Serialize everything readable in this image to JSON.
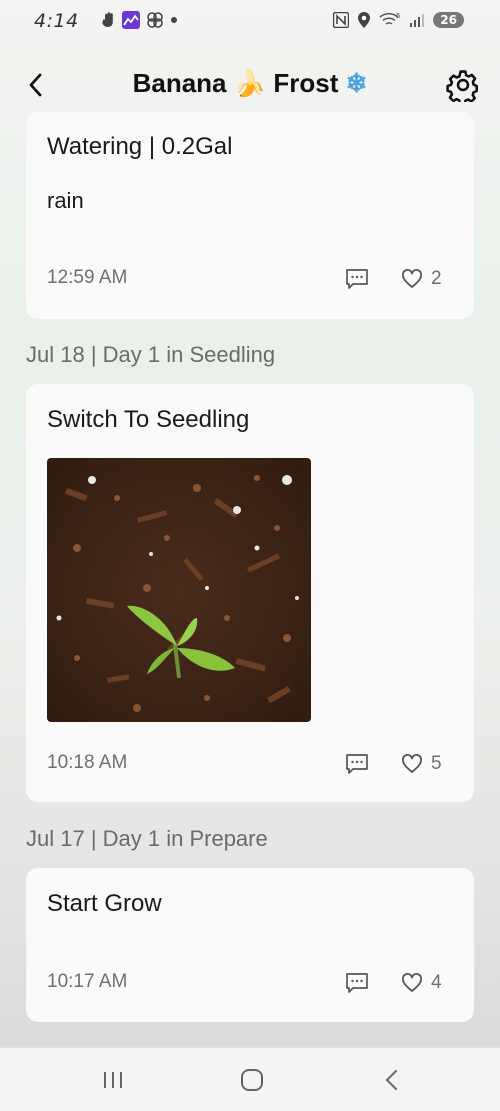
{
  "status_bar": {
    "time": "4:14",
    "battery": "26",
    "signal_label": "5"
  },
  "header": {
    "title_part1": "Banana",
    "title_emoji1": "🍌",
    "title_part2": "Frost",
    "title_emoji2": "❄",
    "back_icon": "chevron-left-icon",
    "settings_icon": "gear-icon"
  },
  "entries": [
    {
      "title": "Watering | 0.2Gal",
      "note": "rain",
      "time": "12:59 AM",
      "likes": "2"
    },
    {
      "date_header": "Jul 18 | Day 1 in Seedling",
      "title": "Switch To Seedling",
      "time": "10:18 AM",
      "likes": "5"
    },
    {
      "date_header": "Jul 17 | Day 1 in Prepare",
      "title": "Start Grow",
      "time": "10:17 AM",
      "likes": "4"
    }
  ],
  "nav": {
    "recents_icon": "recents-icon",
    "home_icon": "home-icon",
    "back_icon": "back-icon"
  },
  "colors": {
    "card_bg": "#fafafa",
    "muted_text": "#6f6f6f",
    "date_text": "#6b6b6b"
  }
}
